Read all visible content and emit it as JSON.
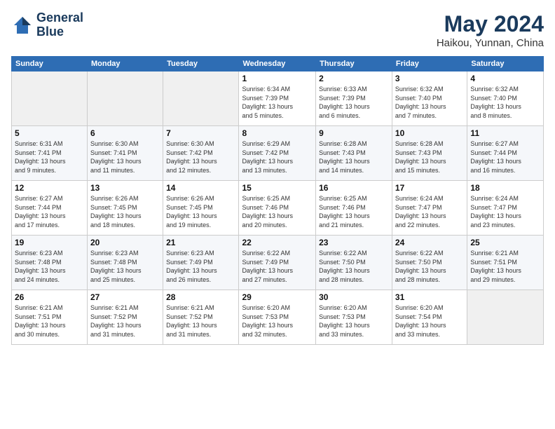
{
  "logo": {
    "line1": "General",
    "line2": "Blue"
  },
  "title": "May 2024",
  "location": "Haikou, Yunnan, China",
  "days_of_week": [
    "Sunday",
    "Monday",
    "Tuesday",
    "Wednesday",
    "Thursday",
    "Friday",
    "Saturday"
  ],
  "weeks": [
    [
      {
        "day": "",
        "info": ""
      },
      {
        "day": "",
        "info": ""
      },
      {
        "day": "",
        "info": ""
      },
      {
        "day": "1",
        "info": "Sunrise: 6:34 AM\nSunset: 7:39 PM\nDaylight: 13 hours\nand 5 minutes."
      },
      {
        "day": "2",
        "info": "Sunrise: 6:33 AM\nSunset: 7:39 PM\nDaylight: 13 hours\nand 6 minutes."
      },
      {
        "day": "3",
        "info": "Sunrise: 6:32 AM\nSunset: 7:40 PM\nDaylight: 13 hours\nand 7 minutes."
      },
      {
        "day": "4",
        "info": "Sunrise: 6:32 AM\nSunset: 7:40 PM\nDaylight: 13 hours\nand 8 minutes."
      }
    ],
    [
      {
        "day": "5",
        "info": "Sunrise: 6:31 AM\nSunset: 7:41 PM\nDaylight: 13 hours\nand 9 minutes."
      },
      {
        "day": "6",
        "info": "Sunrise: 6:30 AM\nSunset: 7:41 PM\nDaylight: 13 hours\nand 11 minutes."
      },
      {
        "day": "7",
        "info": "Sunrise: 6:30 AM\nSunset: 7:42 PM\nDaylight: 13 hours\nand 12 minutes."
      },
      {
        "day": "8",
        "info": "Sunrise: 6:29 AM\nSunset: 7:42 PM\nDaylight: 13 hours\nand 13 minutes."
      },
      {
        "day": "9",
        "info": "Sunrise: 6:28 AM\nSunset: 7:43 PM\nDaylight: 13 hours\nand 14 minutes."
      },
      {
        "day": "10",
        "info": "Sunrise: 6:28 AM\nSunset: 7:43 PM\nDaylight: 13 hours\nand 15 minutes."
      },
      {
        "day": "11",
        "info": "Sunrise: 6:27 AM\nSunset: 7:44 PM\nDaylight: 13 hours\nand 16 minutes."
      }
    ],
    [
      {
        "day": "12",
        "info": "Sunrise: 6:27 AM\nSunset: 7:44 PM\nDaylight: 13 hours\nand 17 minutes."
      },
      {
        "day": "13",
        "info": "Sunrise: 6:26 AM\nSunset: 7:45 PM\nDaylight: 13 hours\nand 18 minutes."
      },
      {
        "day": "14",
        "info": "Sunrise: 6:26 AM\nSunset: 7:45 PM\nDaylight: 13 hours\nand 19 minutes."
      },
      {
        "day": "15",
        "info": "Sunrise: 6:25 AM\nSunset: 7:46 PM\nDaylight: 13 hours\nand 20 minutes."
      },
      {
        "day": "16",
        "info": "Sunrise: 6:25 AM\nSunset: 7:46 PM\nDaylight: 13 hours\nand 21 minutes."
      },
      {
        "day": "17",
        "info": "Sunrise: 6:24 AM\nSunset: 7:47 PM\nDaylight: 13 hours\nand 22 minutes."
      },
      {
        "day": "18",
        "info": "Sunrise: 6:24 AM\nSunset: 7:47 PM\nDaylight: 13 hours\nand 23 minutes."
      }
    ],
    [
      {
        "day": "19",
        "info": "Sunrise: 6:23 AM\nSunset: 7:48 PM\nDaylight: 13 hours\nand 24 minutes."
      },
      {
        "day": "20",
        "info": "Sunrise: 6:23 AM\nSunset: 7:48 PM\nDaylight: 13 hours\nand 25 minutes."
      },
      {
        "day": "21",
        "info": "Sunrise: 6:23 AM\nSunset: 7:49 PM\nDaylight: 13 hours\nand 26 minutes."
      },
      {
        "day": "22",
        "info": "Sunrise: 6:22 AM\nSunset: 7:49 PM\nDaylight: 13 hours\nand 27 minutes."
      },
      {
        "day": "23",
        "info": "Sunrise: 6:22 AM\nSunset: 7:50 PM\nDaylight: 13 hours\nand 28 minutes."
      },
      {
        "day": "24",
        "info": "Sunrise: 6:22 AM\nSunset: 7:50 PM\nDaylight: 13 hours\nand 28 minutes."
      },
      {
        "day": "25",
        "info": "Sunrise: 6:21 AM\nSunset: 7:51 PM\nDaylight: 13 hours\nand 29 minutes."
      }
    ],
    [
      {
        "day": "26",
        "info": "Sunrise: 6:21 AM\nSunset: 7:51 PM\nDaylight: 13 hours\nand 30 minutes."
      },
      {
        "day": "27",
        "info": "Sunrise: 6:21 AM\nSunset: 7:52 PM\nDaylight: 13 hours\nand 31 minutes."
      },
      {
        "day": "28",
        "info": "Sunrise: 6:21 AM\nSunset: 7:52 PM\nDaylight: 13 hours\nand 31 minutes."
      },
      {
        "day": "29",
        "info": "Sunrise: 6:20 AM\nSunset: 7:53 PM\nDaylight: 13 hours\nand 32 minutes."
      },
      {
        "day": "30",
        "info": "Sunrise: 6:20 AM\nSunset: 7:53 PM\nDaylight: 13 hours\nand 33 minutes."
      },
      {
        "day": "31",
        "info": "Sunrise: 6:20 AM\nSunset: 7:54 PM\nDaylight: 13 hours\nand 33 minutes."
      },
      {
        "day": "",
        "info": ""
      }
    ]
  ]
}
